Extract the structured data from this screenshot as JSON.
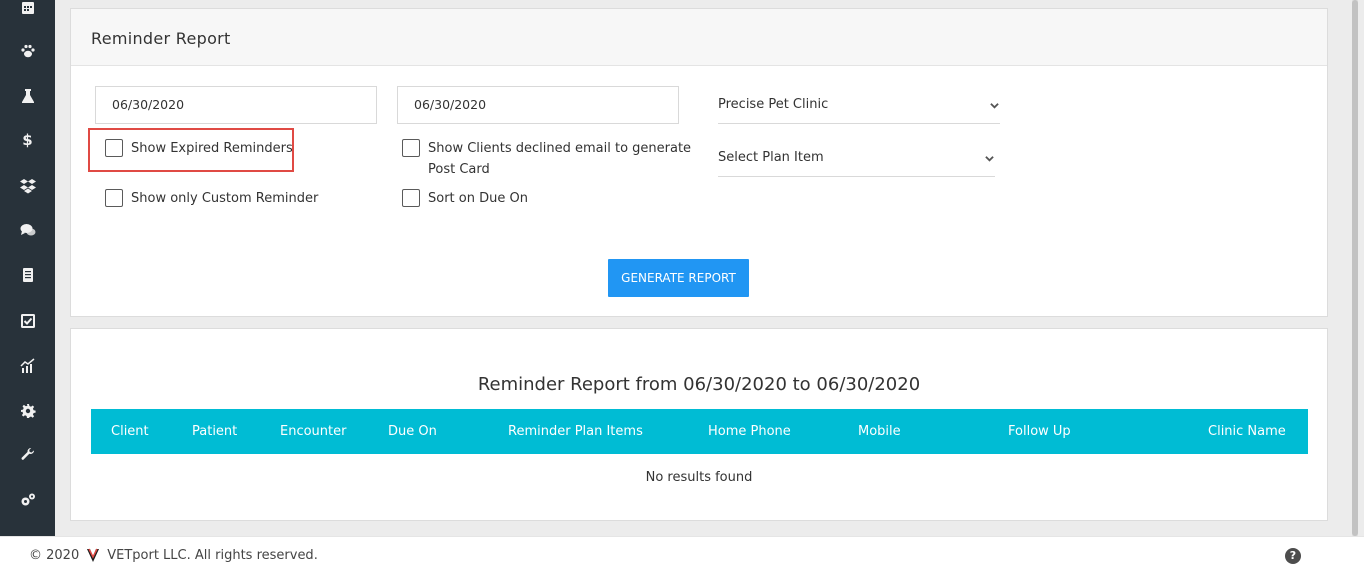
{
  "sidebar": {
    "icons": [
      "calendar-icon",
      "paw-icon",
      "flask-icon",
      "dollar-icon",
      "boxes-icon",
      "chat-icon",
      "ledger-icon",
      "checkbox-icon",
      "chart-icon",
      "gear-icon",
      "wrench-icon",
      "gears-icon"
    ],
    "dollar_glyph": "$"
  },
  "report_panel": {
    "title": "Reminder Report",
    "from_date": "06/30/2020",
    "to_date": "06/30/2020",
    "clinic_select": "Precise Pet Clinic",
    "plan_item_select": "Select Plan Item",
    "checkboxes": {
      "show_expired": "Show Expired Reminders",
      "show_custom": "Show only Custom Reminder",
      "show_declined": "Show Clients declined email to generate Post Card",
      "sort_due": "Sort on Due On"
    },
    "generate_button": "GENERATE REPORT"
  },
  "results_panel": {
    "title": "Reminder Report from 06/30/2020 to 06/30/2020",
    "columns": [
      "Client",
      "Patient",
      "Encounter",
      "Due On",
      "Reminder Plan Items",
      "Home Phone",
      "Mobile",
      "Follow Up",
      "Clinic Name"
    ],
    "empty_message": "No results found"
  },
  "footer": {
    "copyright": "© 2020",
    "company": "VETport LLC. All rights reserved.",
    "help_glyph": "?"
  },
  "colors": {
    "sidebar_bg": "#28323a",
    "button_bg": "#2196f3",
    "table_header_bg": "#00bcd4",
    "highlight_border": "#e04a44"
  }
}
